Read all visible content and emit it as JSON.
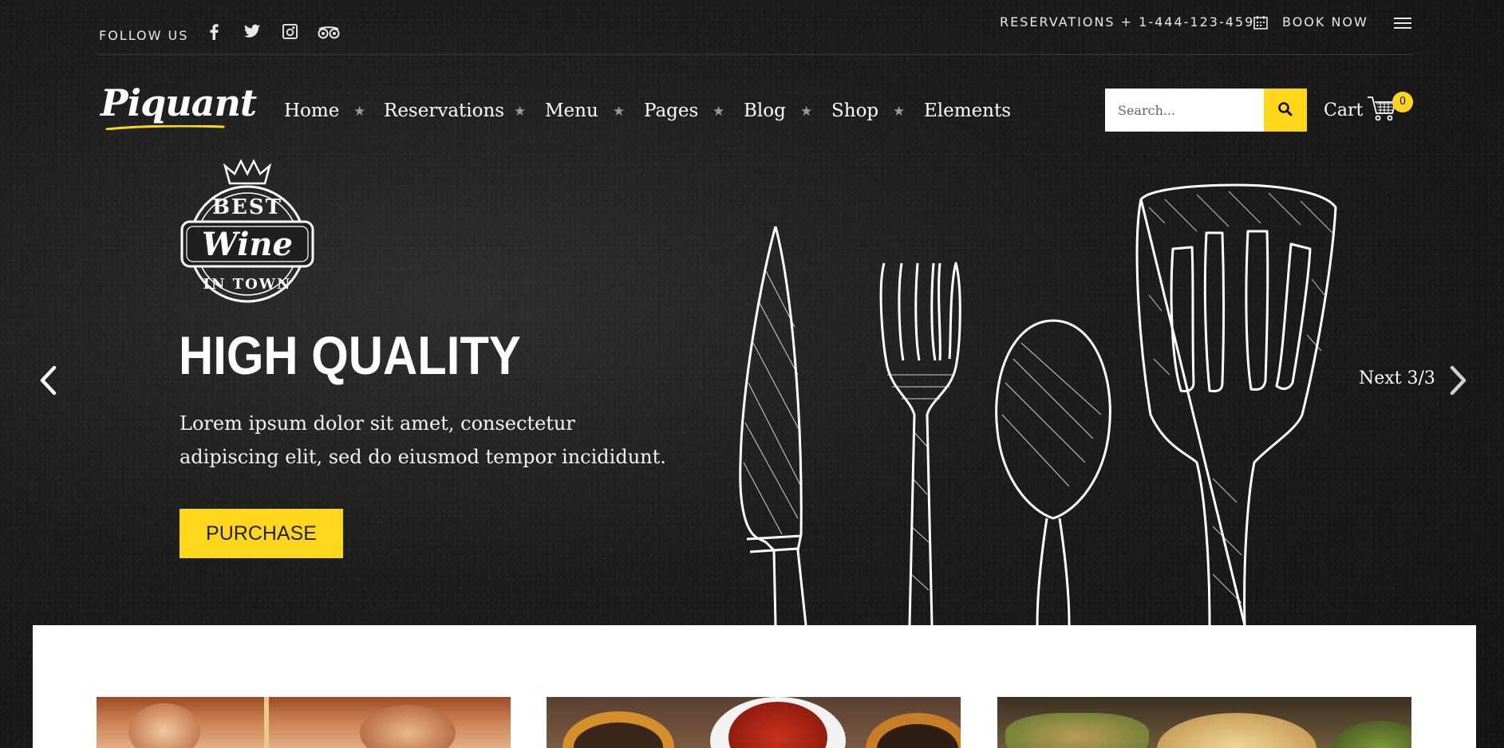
{
  "topbar": {
    "follow_label": "FOLLOW US",
    "social_icons": [
      "facebook-icon",
      "twitter-icon",
      "instagram-icon",
      "tripadvisor-icon"
    ],
    "reservations_label": "RESERVATIONS + 1-444-123-459",
    "book_now_label": "BOOK NOW"
  },
  "header": {
    "logo_text": "Piquant",
    "nav": [
      "Home",
      "Reservations",
      "Menu",
      "Pages",
      "Blog",
      "Shop",
      "Elements"
    ],
    "search_placeholder": "Search...",
    "cart_label": "Cart",
    "cart_count": "0"
  },
  "hero": {
    "badge_top": "BEST",
    "badge_middle": "Wine",
    "badge_bottom": "IN TOWN",
    "title": "HIGH QUALITY",
    "text": "Lorem ipsum dolor sit amet, consectetur adipiscing elit, sed do eiusmod tempor incididunt.",
    "button_label": "PURCHASE",
    "next_label": "Next 3/3"
  },
  "colors": {
    "accent": "#fed71c",
    "background": "#1c1c1c",
    "panel": "#ffffff"
  }
}
